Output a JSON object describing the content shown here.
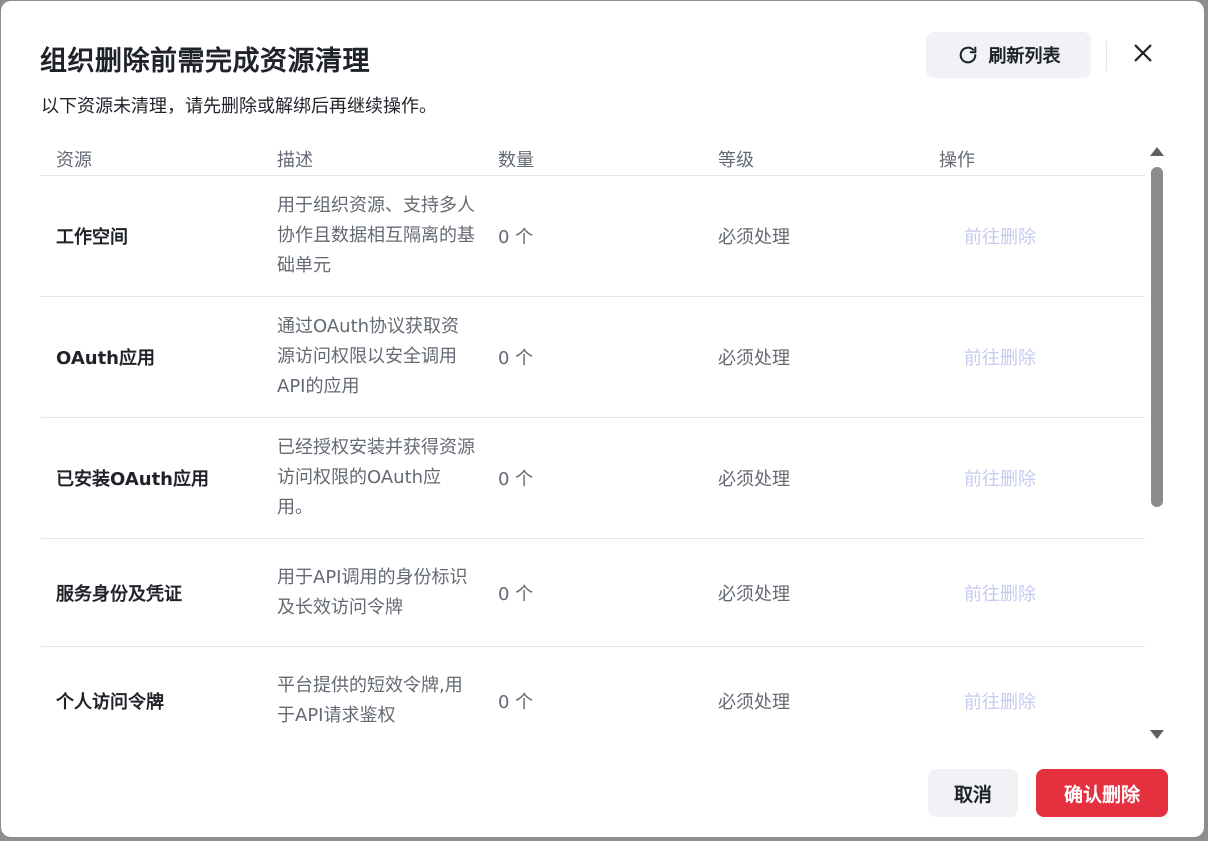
{
  "dialog": {
    "title": "组织删除前需完成资源清理",
    "subtitle": "以下资源未清理，请先删除或解绑后再继续操作。",
    "refresh_label": "刷新列表",
    "refresh_icon": "refresh-icon",
    "close_icon": "close-icon"
  },
  "table": {
    "headers": [
      "资源",
      "描述",
      "数量",
      "等级",
      "操作"
    ],
    "rows": [
      {
        "name": "工作空间",
        "desc": "用于组织资源、支持多人协作且数据相互隔离的基础单元",
        "count": "0 个",
        "level": "必须处理",
        "action": "前往删除"
      },
      {
        "name": "OAuth应用",
        "desc": "通过OAuth协议获取资源访问权限以安全调用API的应用",
        "count": "0 个",
        "level": "必须处理",
        "action": "前往删除"
      },
      {
        "name": "已安装OAuth应用",
        "desc": "已经授权安装并获得资源访问权限的OAuth应用。",
        "count": "0 个",
        "level": "必须处理",
        "action": "前往删除"
      },
      {
        "name": "服务身份及凭证",
        "desc": "用于API调用的身份标识及长效访问令牌",
        "count": "0 个",
        "level": "必须处理",
        "action": "前往删除"
      },
      {
        "name": "个人访问令牌",
        "desc": "平台提供的短效令牌,用于API请求鉴权",
        "count": "0 个",
        "level": "必须处理",
        "action": "前往删除"
      }
    ]
  },
  "footer": {
    "cancel_label": "取消",
    "confirm_label": "确认删除"
  },
  "colors": {
    "danger": "#e5303f",
    "disabled_link": "#c6caf0",
    "secondary_bg": "#f1f2f6"
  }
}
